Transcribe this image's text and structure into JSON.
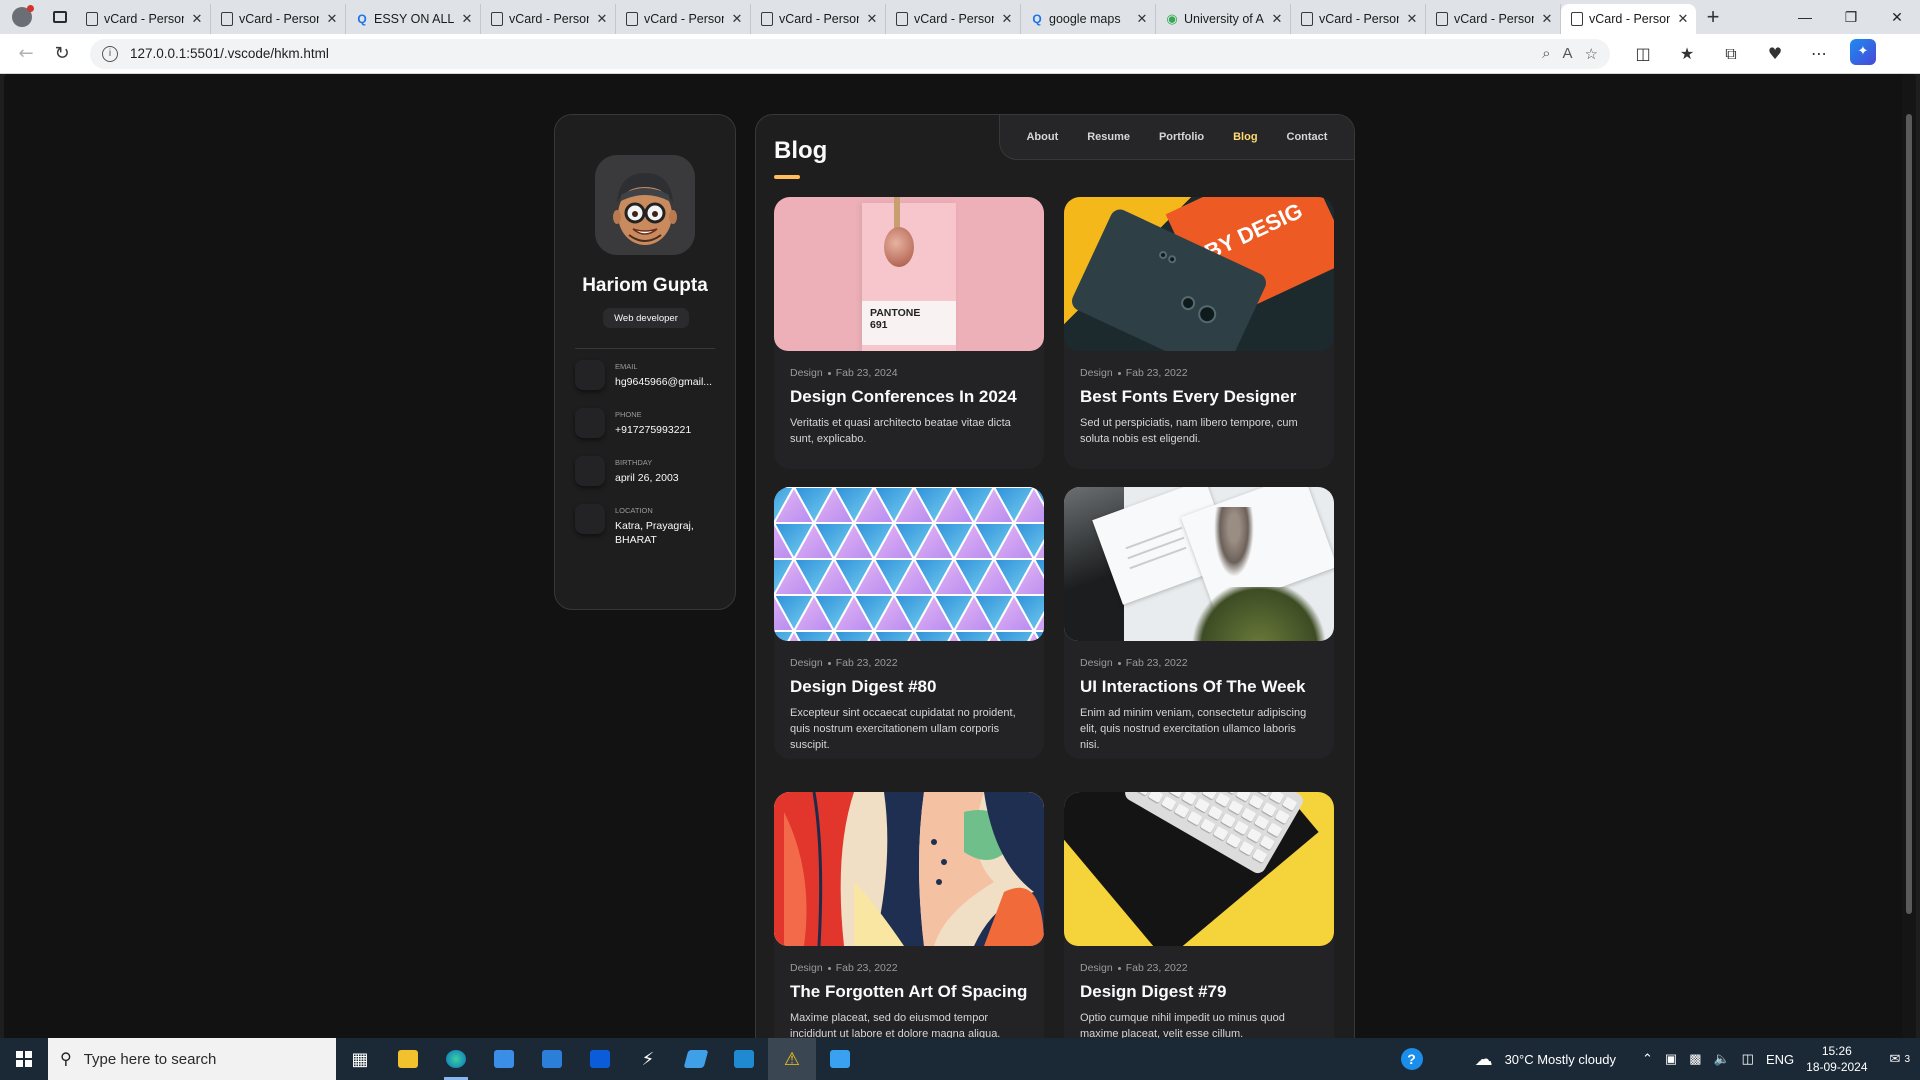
{
  "browser": {
    "tabs": [
      {
        "title": "vCard - Personal",
        "icon": "page-icon"
      },
      {
        "title": "vCard - Personal",
        "icon": "page-icon"
      },
      {
        "title": "ESSY ON ALL A",
        "icon": "search-icon"
      },
      {
        "title": "vCard - Personal",
        "icon": "page-icon"
      },
      {
        "title": "vCard - Personal",
        "icon": "page-icon"
      },
      {
        "title": "vCard - Personal",
        "icon": "page-icon"
      },
      {
        "title": "vCard - Personal",
        "icon": "page-icon"
      },
      {
        "title": "google maps",
        "icon": "search-icon"
      },
      {
        "title": "University of A",
        "icon": "maps-icon"
      },
      {
        "title": "vCard - Personal",
        "icon": "page-icon"
      },
      {
        "title": "vCard - Personal",
        "icon": "page-icon"
      },
      {
        "title": "vCard - Personal",
        "icon": "page-icon",
        "active": true
      }
    ],
    "url": "127.0.0.1:5501/.vscode/hkm.html"
  },
  "sidebar": {
    "name": "Hariom Gupta",
    "role": "Web developer",
    "contacts": [
      {
        "label": "Email",
        "value": "hg9645966@gmail..."
      },
      {
        "label": "Phone",
        "value": "+917275993221"
      },
      {
        "label": "Birthday",
        "value": "april 26, 2003"
      },
      {
        "label": "Location",
        "value": "Katra, Prayagraj, BHARAT"
      }
    ]
  },
  "navbar": {
    "links": [
      "About",
      "Resume",
      "Portfolio",
      "Blog",
      "Contact"
    ],
    "active": "Blog"
  },
  "blog": {
    "title": "Blog",
    "posts": [
      {
        "category": "Design",
        "date": "Fab 23, 2024",
        "title": "Design Conferences In 2024",
        "text": "Veritatis et quasi architecto beatae vitae dicta sunt, explicabo.",
        "image_label": "PANTONE\n691"
      },
      {
        "category": "Design",
        "date": "Fab 23, 2022",
        "title": "Best Fonts Every Designer",
        "text": "Sed ut perspiciatis, nam libero tempore, cum soluta nobis est eligendi.",
        "image_label": "BY DESIG"
      },
      {
        "category": "Design",
        "date": "Fab 23, 2022",
        "title": "Design Digest #80",
        "text": "Excepteur sint occaecat cupidatat no proident, quis nostrum exercitationem ullam corporis suscipit."
      },
      {
        "category": "Design",
        "date": "Fab 23, 2022",
        "title": "UI Interactions Of The Week",
        "text": "Enim ad minim veniam, consectetur adipiscing elit, quis nostrud exercitation ullamco laboris nisi."
      },
      {
        "category": "Design",
        "date": "Fab 23, 2022",
        "title": "The Forgotten Art Of Spacing",
        "text": "Maxime placeat, sed do eiusmod tempor incididunt ut labore et dolore magna aliqua."
      },
      {
        "category": "Design",
        "date": "Fab 23, 2022",
        "title": "Design Digest #79",
        "text": "Optio cumque nihil impedit uo minus quod maxime placeat, velit esse cillum."
      }
    ]
  },
  "taskbar": {
    "search_placeholder": "Type here to search",
    "weather": "30°C  Mostly cloudy",
    "language": "ENG",
    "time": "15:26",
    "date": "18-09-2024",
    "notifications": "3"
  }
}
